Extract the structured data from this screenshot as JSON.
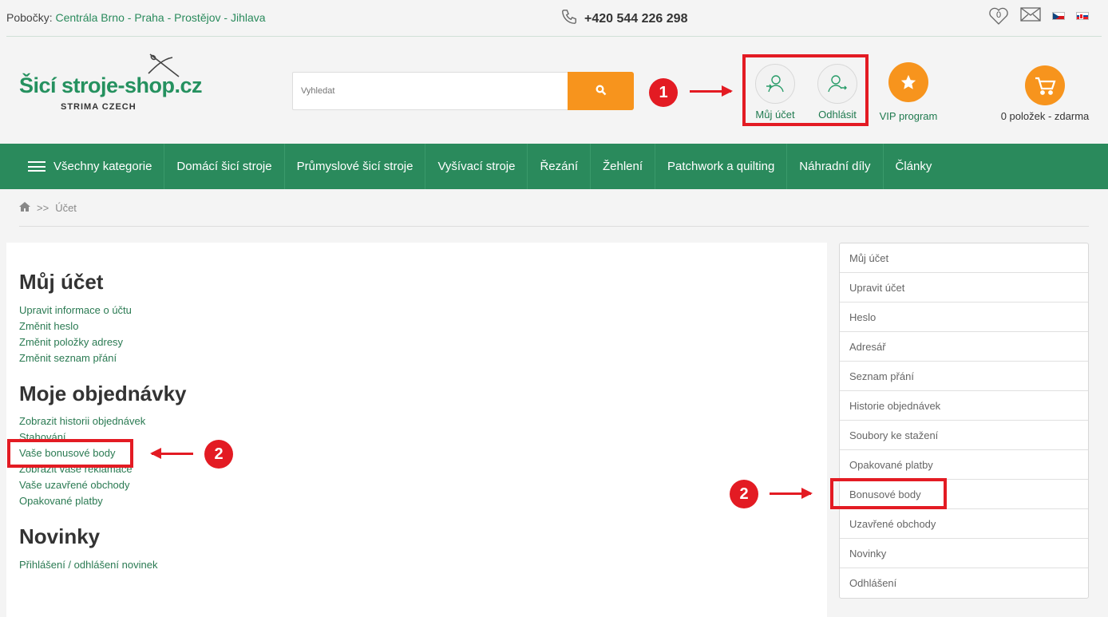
{
  "topbar": {
    "branches_label": "Pobočky:",
    "branches": [
      "Centrála Brno",
      "Praha",
      "Prostějov",
      "Jihlava"
    ],
    "separator": " - ",
    "phone": "+420 544 226 298",
    "wishlist_count": "0"
  },
  "logo": {
    "title": "Šicí stroje-shop.cz",
    "subtitle": "STRIMA CZECH"
  },
  "search": {
    "placeholder": "Vyhledat"
  },
  "account": {
    "my_account": "Můj účet",
    "logout": "Odhlásit"
  },
  "vip": {
    "label": "VIP program"
  },
  "cart": {
    "label": "0 položek - zdarma"
  },
  "nav": {
    "all_categories": "Všechny kategorie",
    "items": [
      "Domácí šicí stroje",
      "Průmyslové šicí stroje",
      "Vyšívací stroje",
      "Řezání",
      "Žehlení",
      "Patchwork a quilting",
      "Náhradní díly",
      "Články"
    ]
  },
  "breadcrumb": {
    "separator": ">>",
    "current": "Účet"
  },
  "main": {
    "sections": [
      {
        "title": "Můj účet",
        "links": [
          "Upravit informace o účtu",
          "Změnit heslo",
          "Změnit položky adresy",
          "Změnit seznam přání"
        ]
      },
      {
        "title": "Moje objednávky",
        "links": [
          "Zobrazit historii objednávek",
          "Stahování",
          "Vaše bonusové body",
          "Zobrazit vaše reklamace",
          "Vaše uzavřené obchody",
          "Opakované platby"
        ]
      },
      {
        "title": "Novinky",
        "links": [
          "Přihlášení / odhlášení novinek"
        ]
      }
    ]
  },
  "sidebar": {
    "items": [
      "Můj účet",
      "Upravit účet",
      "Heslo",
      "Adresář",
      "Seznam přání",
      "Historie objednávek",
      "Soubory ke stažení",
      "Opakované platby",
      "Bonusové body",
      "Uzavřené obchody",
      "Novinky",
      "Odhlášení"
    ]
  },
  "annotations": {
    "badge_1": "1",
    "badge_2": "2"
  },
  "colors": {
    "brand_green": "#2a8a5c",
    "accent_orange": "#f7941d",
    "annotation_red": "#e31b23"
  }
}
